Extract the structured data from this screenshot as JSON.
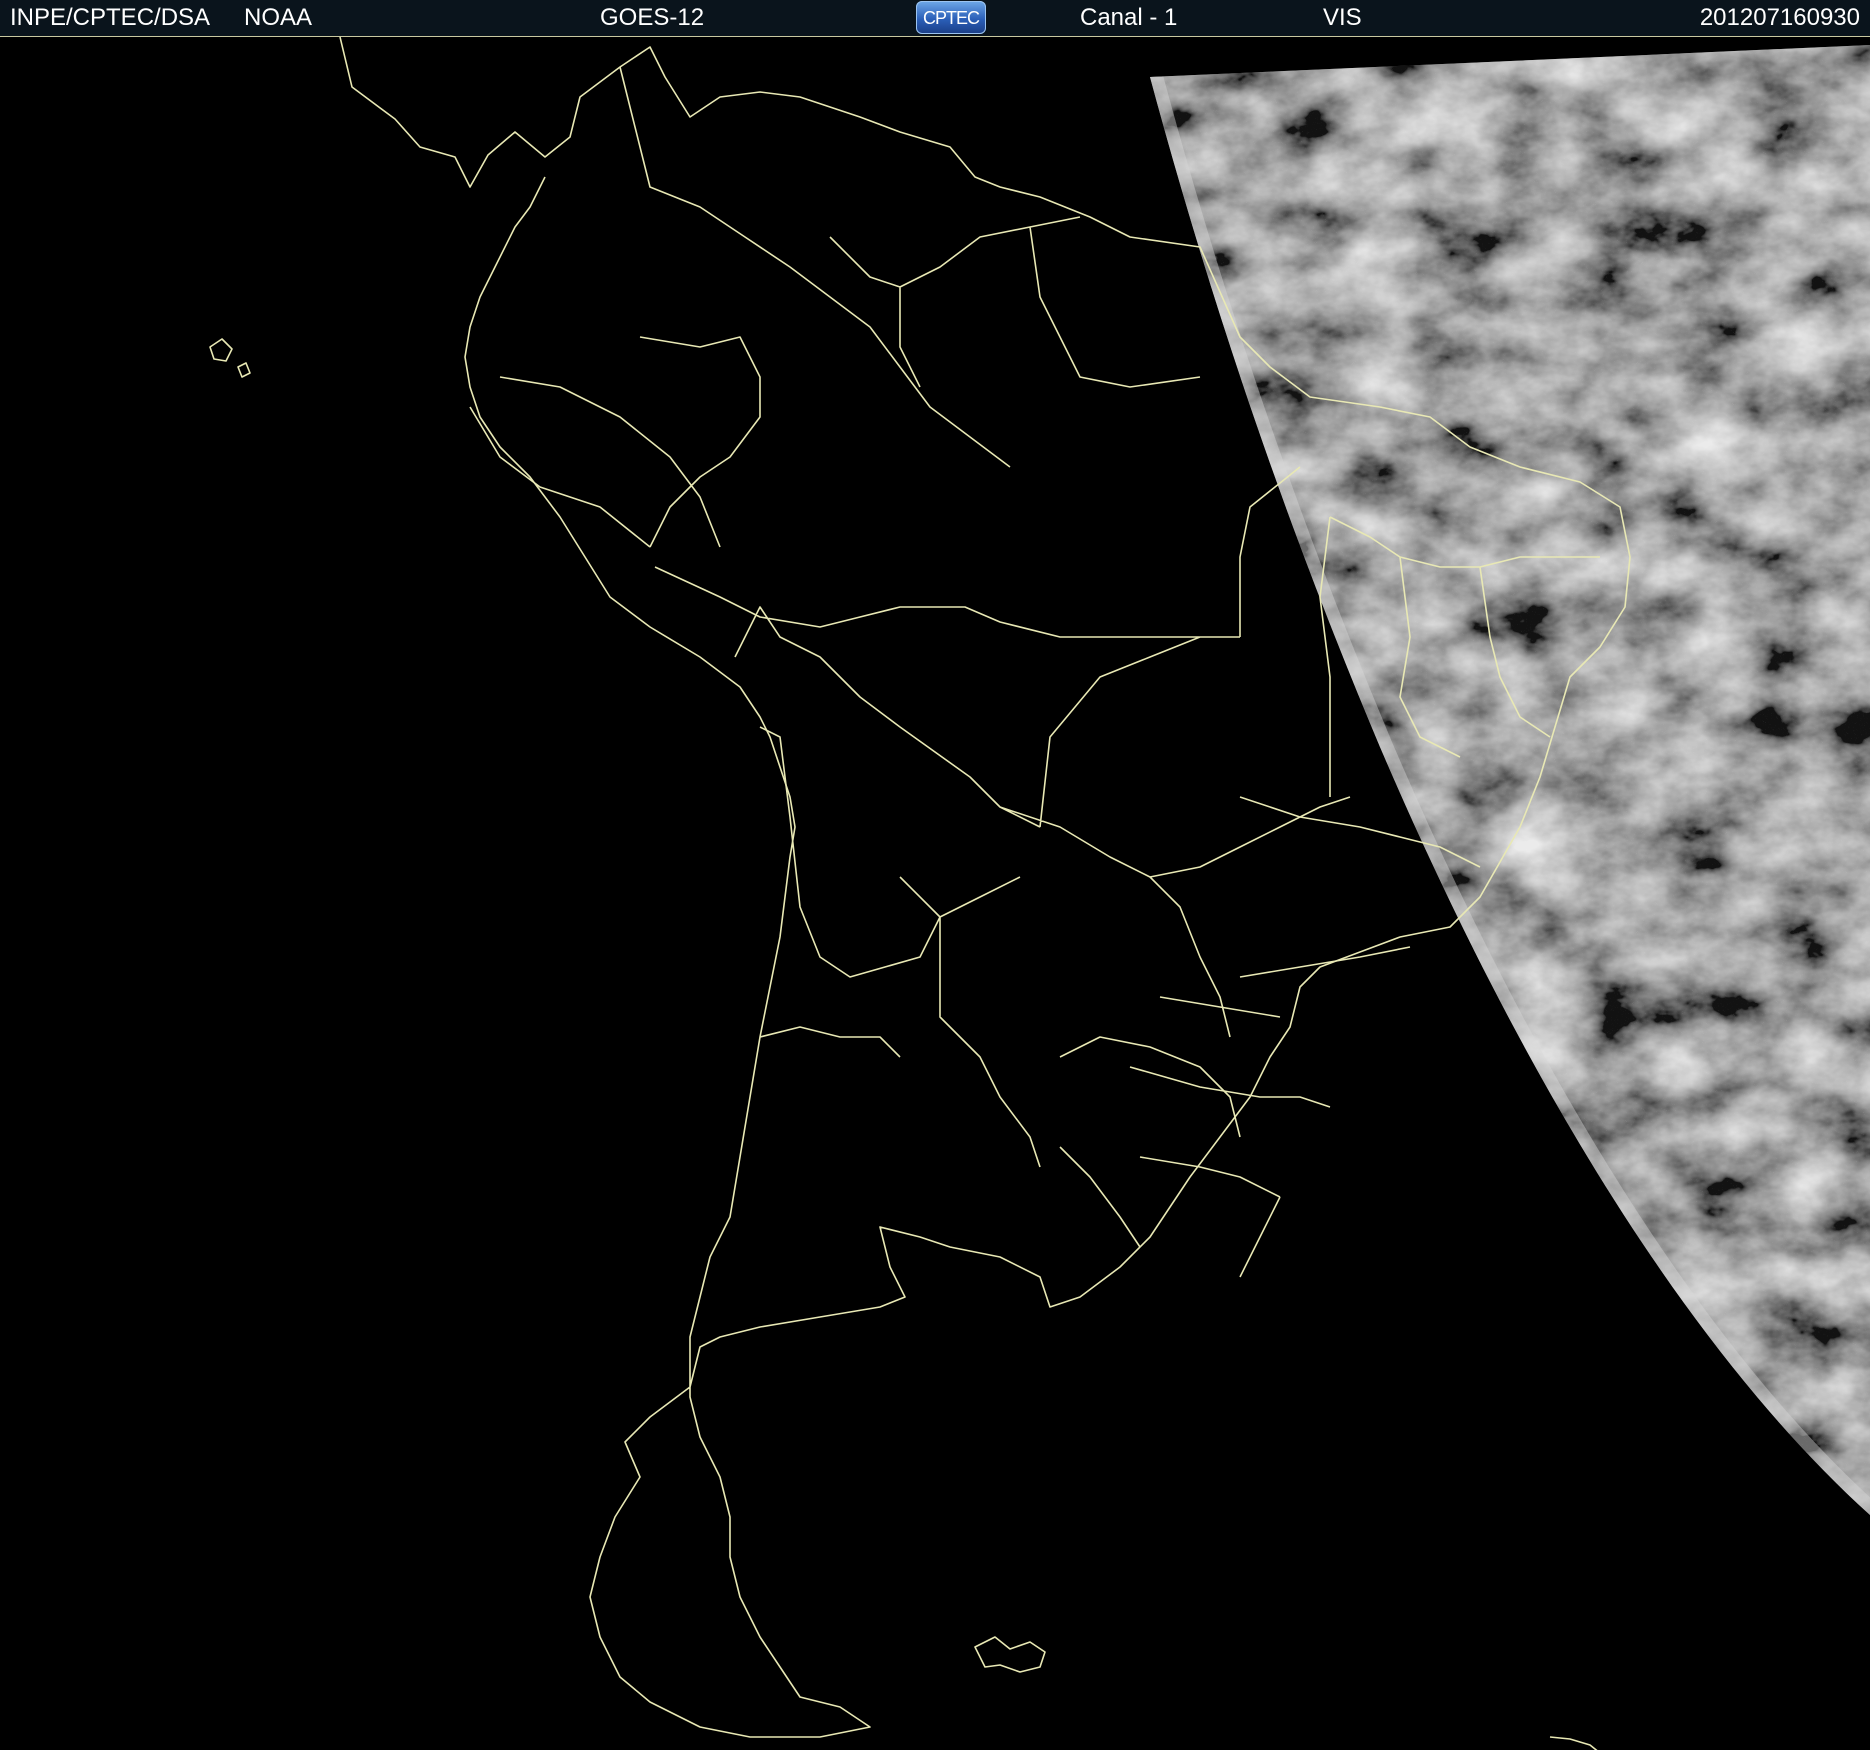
{
  "header": {
    "institution": "INPE/CPTEC/DSA",
    "agency": "NOAA",
    "satellite": "GOES-12",
    "logo_text": "CPTEC",
    "channel": "Canal - 1",
    "band": "VIS",
    "timestamp": "201207160930"
  },
  "colors": {
    "background": "#000000",
    "header_background": "#0a141c",
    "boundary_lines": "#e8e8b4",
    "cloud_field": "#8a8a8a",
    "text": "#ffffff"
  },
  "map": {
    "region": "South America",
    "projection_view": "satellite visible imagery, daylight terminator on east",
    "layers": [
      "coastlines",
      "country-borders",
      "brazilian-state-borders",
      "visible-cloud-imagery"
    ]
  }
}
